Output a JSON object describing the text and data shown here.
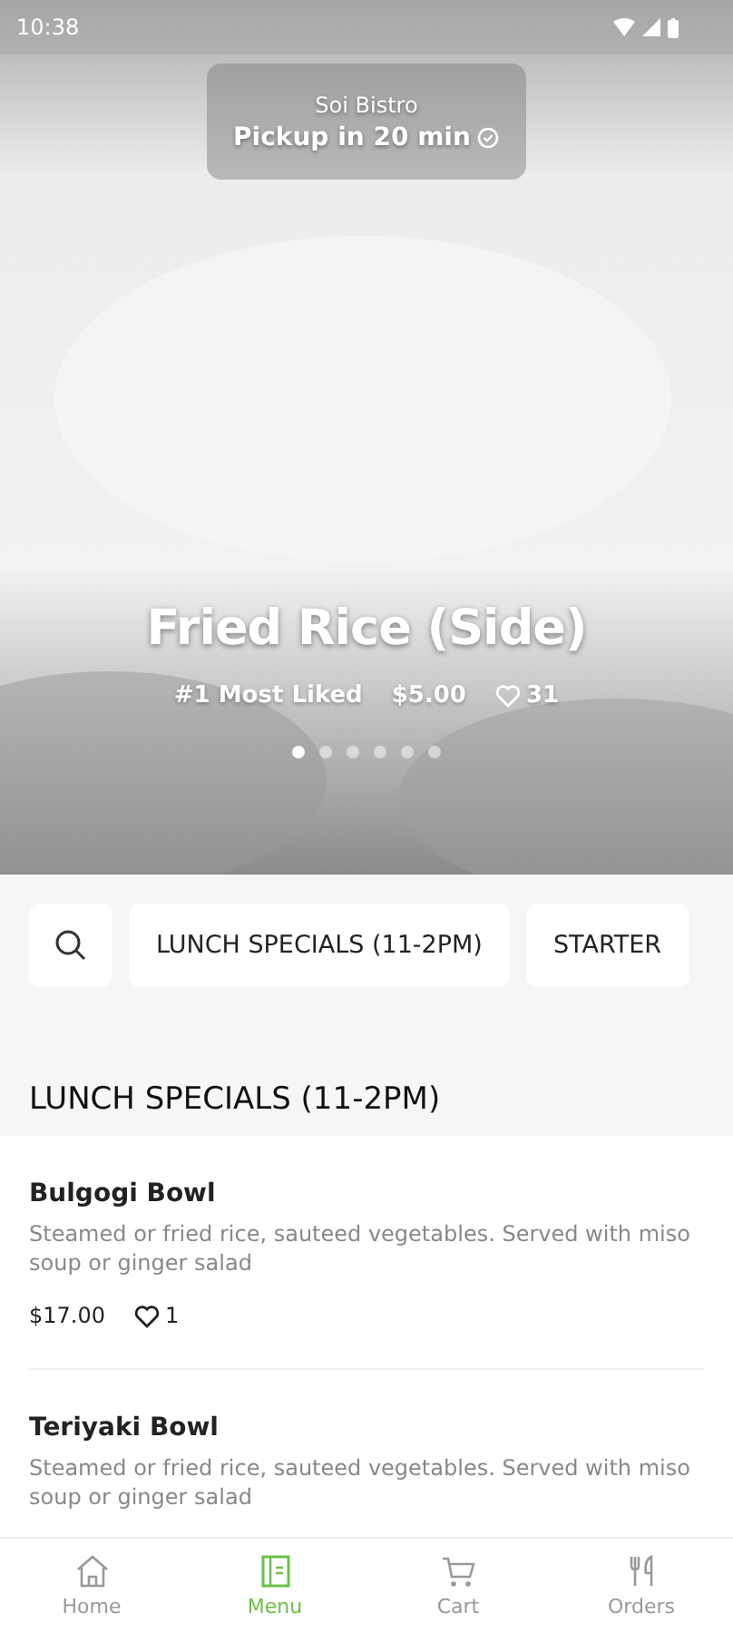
{
  "status_bar": {
    "time": "10:38"
  },
  "store": {
    "name": "Soi Bistro",
    "pickup": "Pickup in 20 min"
  },
  "featured": {
    "title": "Fried Rice (Side)",
    "badge": "#1 Most Liked",
    "price": "$5.00",
    "likes": "31",
    "slides": [
      {
        "selected": true
      },
      {
        "selected": false
      },
      {
        "selected": false
      },
      {
        "selected": false
      },
      {
        "selected": false
      },
      {
        "selected": false
      }
    ]
  },
  "categories": [
    {
      "label": "LUNCH SPECIALS (11-2PM)"
    },
    {
      "label": "STARTER"
    }
  ],
  "section": {
    "title": "LUNCH SPECIALS (11-2PM)"
  },
  "items": [
    {
      "name": "Bulgogi Bowl",
      "description": "Steamed or fried rice, sauteed vegetables. Served with miso soup or ginger salad",
      "price": "$17.00",
      "likes": "1"
    },
    {
      "name": "Teriyaki Bowl",
      "description": "Steamed or fried rice, sauteed vegetables. Served with miso soup or ginger salad"
    }
  ],
  "nav": [
    {
      "label": "Home",
      "kind": "home",
      "selected": false
    },
    {
      "label": "Menu",
      "kind": "menu",
      "selected": true
    },
    {
      "label": "Cart",
      "kind": "cart",
      "selected": false
    },
    {
      "label": "Orders",
      "kind": "orders",
      "selected": false
    }
  ]
}
